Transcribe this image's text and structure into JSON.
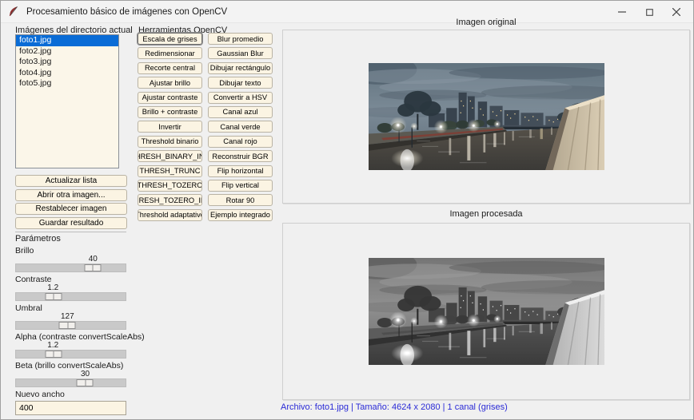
{
  "window": {
    "title": "Procesamiento básico de imágenes con OpenCV"
  },
  "files": {
    "label": "Imágenes del directorio actual",
    "items": [
      "foto1.jpg",
      "foto2.jpg",
      "foto3.jpg",
      "foto4.jpg",
      "foto5.jpg"
    ],
    "selected": "foto1.jpg"
  },
  "actions": [
    "Actualizar lista",
    "Abrir otra imagen...",
    "Restablecer imagen",
    "Guardar resultado"
  ],
  "parameters": {
    "label": "Parámetros",
    "sliders": [
      {
        "label": "Brillo",
        "value": "40",
        "percent": "70%"
      },
      {
        "label": "Contraste",
        "value": "1.2",
        "percent": "34%"
      },
      {
        "label": "Umbral",
        "value": "127",
        "percent": "47%"
      },
      {
        "label": "Alpha (contraste convertScaleAbs)",
        "value": "1.2",
        "percent": "34%"
      },
      {
        "label": "Beta (brillo convertScaleAbs)",
        "value": "30",
        "percent": "63%"
      }
    ],
    "width_label": "Nuevo ancho",
    "width_value": "400"
  },
  "tools": {
    "label": "Herramientas OpenCV",
    "col1": [
      "Escala de grises",
      "Redimensionar",
      "Recorte central",
      "Ajustar brillo",
      "Ajustar contraste",
      "Brillo + contraste",
      "Invertir",
      "Threshold binario",
      "THRESH_BINARY_INV",
      "THRESH_TRUNC",
      "THRESH_TOZERO",
      "THRESH_TOZERO_INV",
      "Threshold adaptativo"
    ],
    "col2": [
      "Blur promedio",
      "Gaussian Blur",
      "Dibujar rectángulo",
      "Dibujar texto",
      "Convertir a HSV",
      "Canal azul",
      "Canal verde",
      "Canal rojo",
      "Reconstruir BGR",
      "Flip horizontal",
      "Flip vertical",
      "Rotar 90",
      "Ejemplo integrado"
    ]
  },
  "viewer": {
    "original_label": "Imagen original",
    "processed_label": "Imagen procesada"
  },
  "status": {
    "text": "Archivo: foto1.jpg | Tamaño: 4624 x 2080 | 1 canal (grises)"
  },
  "colors": {
    "selection_blue": "#0a6cd6",
    "widget_cream": "#fbf4e3",
    "status_text": "#2a2ad6"
  }
}
